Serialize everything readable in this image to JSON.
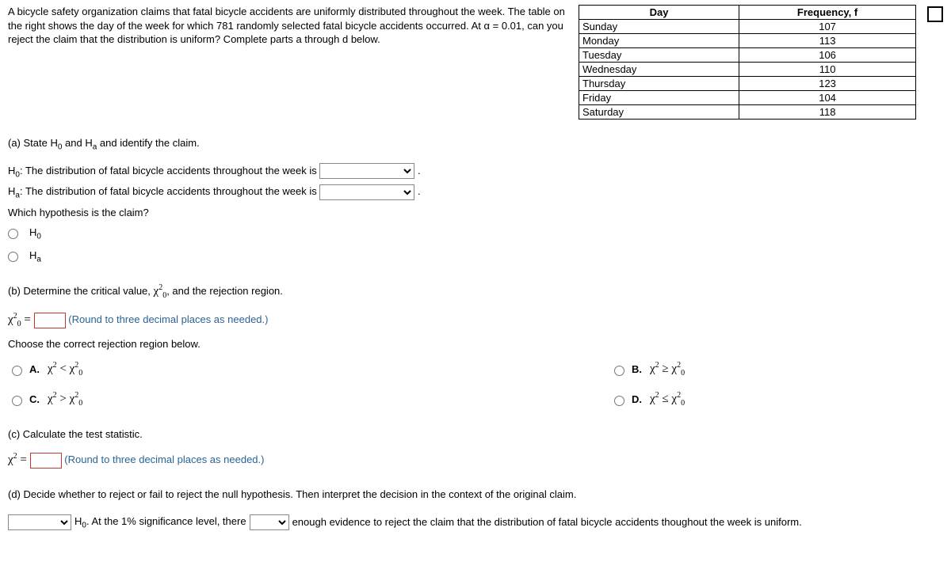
{
  "problem": {
    "text": "A bicycle safety organization claims that fatal bicycle accidents are uniformly distributed throughout the week. The table on the right shows the day of the week for which 781 randomly selected fatal bicycle accidents occurred. At α = 0.01, can you reject the claim that the distribution is uniform? Complete parts a through d below."
  },
  "table": {
    "headers": [
      "Day",
      "Frequency, f"
    ],
    "rows": [
      [
        "Sunday",
        "107"
      ],
      [
        "Monday",
        "113"
      ],
      [
        "Tuesday",
        "106"
      ],
      [
        "Wednesday",
        "110"
      ],
      [
        "Thursday",
        "123"
      ],
      [
        "Friday",
        "104"
      ],
      [
        "Saturday",
        "118"
      ]
    ]
  },
  "chart_data": {
    "type": "table",
    "title": "Fatal bicycle accidents by day of week",
    "categories": [
      "Sunday",
      "Monday",
      "Tuesday",
      "Wednesday",
      "Thursday",
      "Friday",
      "Saturday"
    ],
    "values": [
      107,
      113,
      106,
      110,
      123,
      104,
      118
    ],
    "n": 781,
    "alpha": 0.01
  },
  "parts": {
    "a": {
      "prompt": "(a) State H₀ and Hₐ and identify the claim.",
      "h0_prefix": "H₀: The distribution of fatal bicycle accidents throughout the week is",
      "ha_prefix": "Hₐ: The distribution of fatal bicycle accidents throughout the week is",
      "which": "Which hypothesis is the claim?",
      "opt1": "H₀",
      "opt2": "Hₐ"
    },
    "b": {
      "prompt": "(b) Determine the critical value, χ²₀, and the rejection region.",
      "chi_label": "χ²₀ =",
      "hint": "(Round to three decimal places as needed.)",
      "choose": "Choose the correct rejection region below.",
      "opts": {
        "A": {
          "lbl": "A.",
          "rel": "<"
        },
        "B": {
          "lbl": "B.",
          "rel": "≥"
        },
        "C": {
          "lbl": "C.",
          "rel": ">"
        },
        "D": {
          "lbl": "D.",
          "rel": "≤"
        }
      }
    },
    "c": {
      "prompt": "(c) Calculate the test statistic.",
      "chi_label": "χ² =",
      "hint": "(Round to three decimal places as needed.)"
    },
    "d": {
      "prompt": "(d) Decide whether to reject or fail to reject the null hypothesis. Then interpret the decision in the context of the original claim.",
      "seg1": "H₀. At the 1% significance level, there",
      "seg2": "enough evidence to reject the claim that the distribution of fatal bicycle accidents thoughout the week is uniform."
    }
  }
}
